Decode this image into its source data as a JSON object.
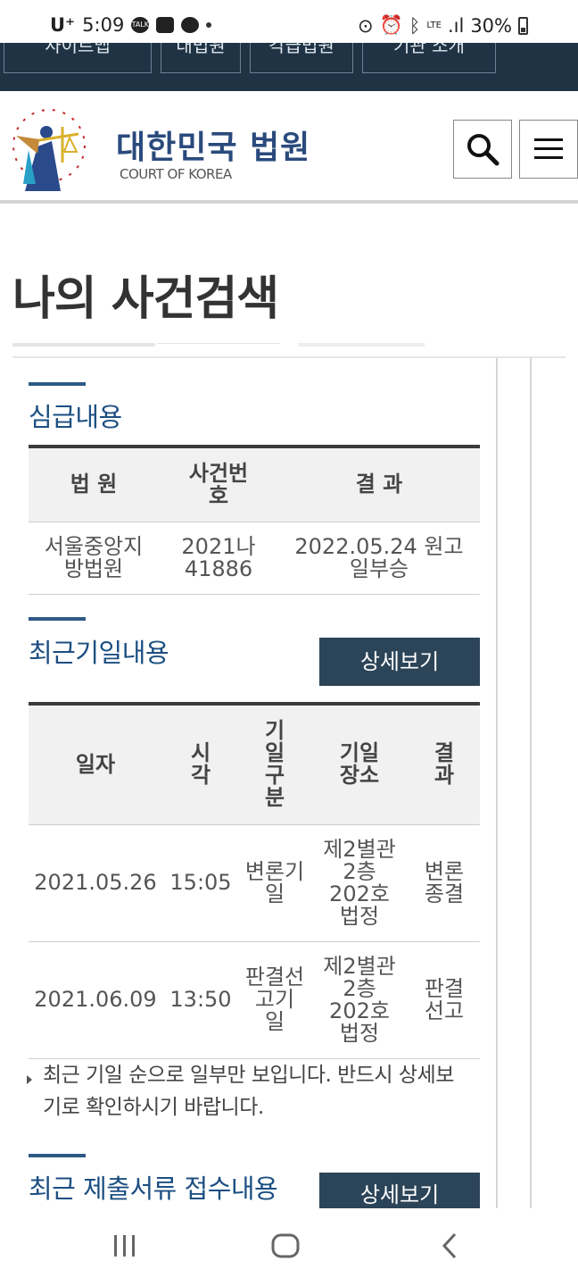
{
  "status_bar": {
    "carrier": "U⁺",
    "time": "5:09",
    "signal_label": "LTE",
    "battery": "30%"
  },
  "top_nav": {
    "buttons": [
      "사이트맵",
      "대법원",
      "각급법원",
      "기관 소개"
    ]
  },
  "header": {
    "logo_title": "대한민국 법원",
    "logo_subtitle": "COURT OF KOREA",
    "search_icon": "search-icon",
    "menu_icon": "hamburger-menu-icon"
  },
  "page": {
    "title": "나의 사건검색"
  },
  "lower_instance": {
    "title": "심급내용",
    "headers": [
      "법 원",
      "사건번\n호",
      "결 과"
    ],
    "rows": [
      {
        "court": "서울중앙지\n방법원",
        "case_no": "2021나\n41886",
        "result": "2022.05.24 원고\n일부승"
      }
    ]
  },
  "recent_dates": {
    "title": "최근기일내용",
    "detail_label": "상세보기",
    "headers": [
      "일자",
      "시\n각",
      "기\n일\n구\n분",
      "기일\n장소",
      "결\n과"
    ],
    "rows": [
      {
        "date": "2021.05.26",
        "time": "15:05",
        "type": "변론기\n일",
        "place": "제2별관\n2층\n202호\n법정",
        "result": "변론\n종결"
      },
      {
        "date": "2021.06.09",
        "time": "13:50",
        "type": "판결선\n고기\n일",
        "place": "제2별관\n2층\n202호\n법정",
        "result": "판결\n선고"
      }
    ],
    "note": "최근 기일 순으로 일부만 보입니다. 반드시 상세보기로 확인하시기 바랍니다."
  },
  "recent_documents": {
    "title": "최근 제출서류 접수내용",
    "detail_label": "상세보기"
  },
  "colors": {
    "nav_dark": "#1f3344",
    "brand_blue": "#2a4a7c",
    "section_title": "#1c4f82",
    "button_dark": "#2c4458",
    "link_blue": "#2b5c9a"
  }
}
